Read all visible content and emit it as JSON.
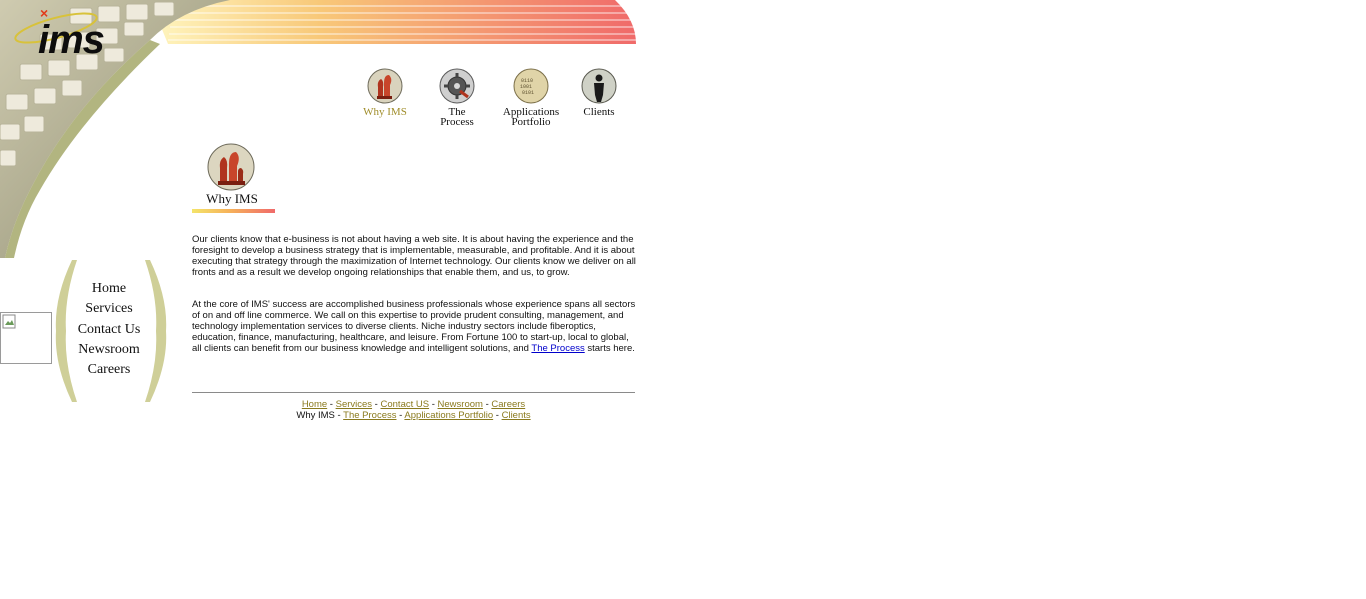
{
  "logo": {
    "text": "ims"
  },
  "topnav": [
    {
      "label": "Why IMS",
      "active": true,
      "icon": "chess-pieces-icon"
    },
    {
      "label": "The Process",
      "active": false,
      "icon": "gear-icon"
    },
    {
      "label": "Applications Portfolio",
      "active": false,
      "icon": "binary-coin-icon"
    },
    {
      "label": "Clients",
      "active": false,
      "icon": "businessman-icon"
    }
  ],
  "section": {
    "title": "Why IMS"
  },
  "content": {
    "para1": "Our clients know that e-business is not about having a web site. It is about having the experience and the foresight to develop a business strategy that is implementable, measurable, and profitable. And it is about executing that strategy through the maximization of Internet technology. Our clients know we deliver on all fronts and as a result we develop ongoing relationships that enable them, and us, to grow.",
    "para2_text": "At the core of IMS' success are accomplished business professionals whose experience spans all sectors of on and off line commerce. We call on this expertise to provide prudent consulting, management, and technology implementation services to diverse clients. Niche industry sectors include fiberoptics, education, finance, manufacturing, healthcare, and leisure. From Fortune 100 to start-up, local to global, all clients can benefit from our business knowledge and intelligent solutions, and ",
    "para2_link": "The Process",
    "para2_end": " starts here."
  },
  "sidenav": [
    "Home",
    "Services",
    "Contact Us",
    "Newsroom",
    "Careers"
  ],
  "footer": {
    "row1": [
      "Home",
      "Services",
      "Contact US",
      "Newsroom",
      "Careers"
    ],
    "row2_current": "Why IMS",
    "row2": [
      "The Process",
      "Applications Portfolio",
      "Clients"
    ],
    "separator": " - "
  },
  "colors": {
    "accent_pink": "#f06a6a",
    "accent_yellow": "#f4e46a",
    "footer_link": "#8a7a1e",
    "body_link": "#0000cc",
    "bracket": "#c9c98a"
  }
}
